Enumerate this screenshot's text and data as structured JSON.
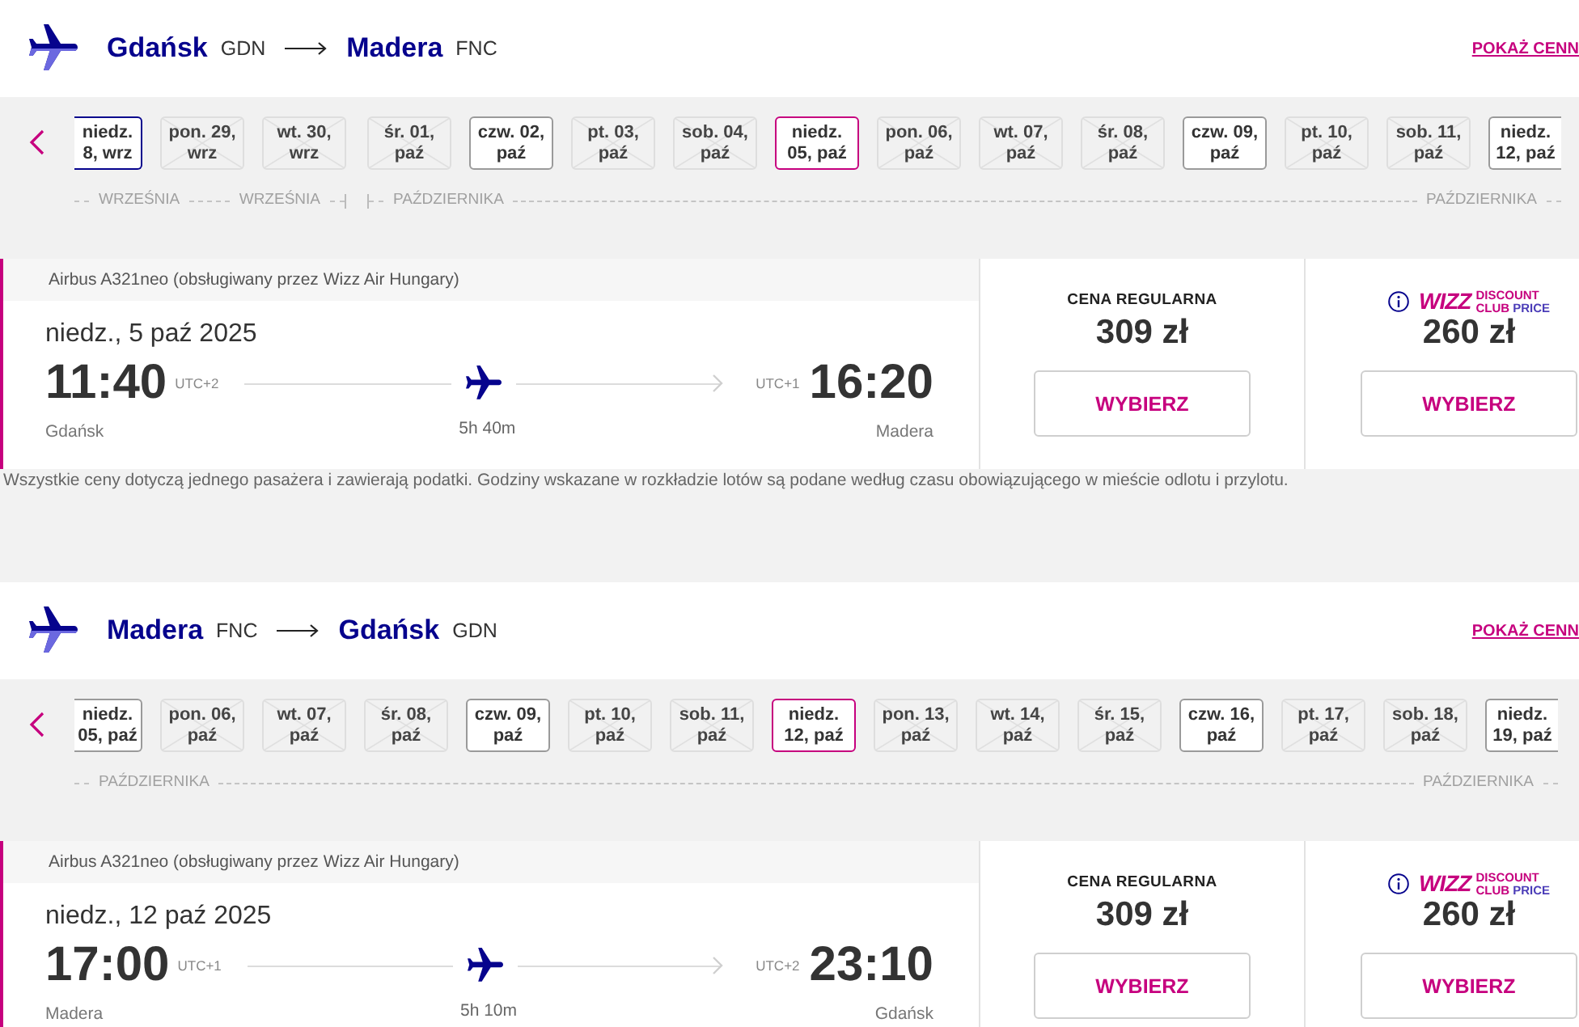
{
  "flights": [
    {
      "route": {
        "origin": "Gdańsk",
        "origin_code": "GDN",
        "destination": "Madera",
        "destination_code": "FNC"
      },
      "price_link": "POKAŻ CENN",
      "date_strip": {
        "months": [
          {
            "labels": [
              "WRZEŚNIA",
              "WRZEŚNIA"
            ],
            "days": [
              {
                "label": "niedz. 8, wrz",
                "available": true,
                "selected": false,
                "focused": true
              },
              {
                "label": "pon. 29, wrz",
                "available": false,
                "selected": false,
                "focused": false
              },
              {
                "label": "wt. 30, wrz",
                "available": false,
                "selected": false,
                "focused": false
              }
            ]
          },
          {
            "labels": [
              "PAŹDZIERNIKA",
              "PAŹDZIERNIKA"
            ],
            "days": [
              {
                "label": "śr. 01, paź",
                "available": false,
                "selected": false,
                "focused": false
              },
              {
                "label": "czw. 02, paź",
                "available": true,
                "selected": false,
                "focused": false
              },
              {
                "label": "pt. 03, paź",
                "available": false,
                "selected": false,
                "focused": false
              },
              {
                "label": "sob. 04, paź",
                "available": false,
                "selected": false,
                "focused": false
              },
              {
                "label": "niedz. 05, paź",
                "available": true,
                "selected": true,
                "focused": false
              },
              {
                "label": "pon. 06, paź",
                "available": false,
                "selected": false,
                "focused": false
              },
              {
                "label": "wt. 07, paź",
                "available": false,
                "selected": false,
                "focused": false
              },
              {
                "label": "śr. 08, paź",
                "available": false,
                "selected": false,
                "focused": false
              },
              {
                "label": "czw. 09, paź",
                "available": true,
                "selected": false,
                "focused": false
              },
              {
                "label": "pt. 10, paź",
                "available": false,
                "selected": false,
                "focused": false
              },
              {
                "label": "sob. 11, paź",
                "available": false,
                "selected": false,
                "focused": false
              },
              {
                "label": "niedz. 12, paź",
                "available": true,
                "selected": false,
                "focused": false
              }
            ]
          }
        ]
      },
      "flight": {
        "selected": true,
        "aircraft": "Airbus A321neo (obsługiwany przez Wizz Air Hungary)",
        "date": "niedz., 5 paź 2025",
        "departure": {
          "time": "11:40",
          "utc_offset": "UTC+2",
          "city": "Gdańsk"
        },
        "duration": "5h 40m",
        "arrival": {
          "time": "16:20",
          "utc_offset": "UTC+1",
          "city": "Madera"
        },
        "fares": [
          {
            "kind": "regular",
            "title": "CENA REGULARNA",
            "price": "309 zł",
            "button": "WYBIERZ"
          },
          {
            "kind": "club",
            "logo": {
              "wordmark": "WIZZ",
              "words": [
                "DISCOUNT",
                "CLUB",
                "PRICE"
              ]
            },
            "price": "260 zł",
            "button": "WYBIERZ"
          }
        ]
      },
      "note": "Wszystkie ceny dotyczą jednego pasażera i zawierają podatki. Godziny wskazane w rozkładzie lotów są podane według czasu obowiązującego w mieście odlotu i przylotu."
    },
    {
      "route": {
        "origin": "Madera",
        "origin_code": "FNC",
        "destination": "Gdańsk",
        "destination_code": "GDN"
      },
      "price_link": "POKAŻ CENN",
      "date_strip": {
        "months": [
          {
            "labels": [
              "PAŹDZIERNIKA",
              "PAŹDZIERNIKA"
            ],
            "days": [
              {
                "label": "niedz. 05, paź",
                "available": true,
                "selected": false,
                "focused": false
              },
              {
                "label": "pon. 06, paź",
                "available": false,
                "selected": false,
                "focused": false
              },
              {
                "label": "wt. 07, paź",
                "available": false,
                "selected": false,
                "focused": false
              },
              {
                "label": "śr. 08, paź",
                "available": false,
                "selected": false,
                "focused": false
              },
              {
                "label": "czw. 09, paź",
                "available": true,
                "selected": false,
                "focused": false
              },
              {
                "label": "pt. 10, paź",
                "available": false,
                "selected": false,
                "focused": false
              },
              {
                "label": "sob. 11, paź",
                "available": false,
                "selected": false,
                "focused": false
              },
              {
                "label": "niedz. 12, paź",
                "available": true,
                "selected": true,
                "focused": false
              },
              {
                "label": "pon. 13, paź",
                "available": false,
                "selected": false,
                "focused": false
              },
              {
                "label": "wt. 14, paź",
                "available": false,
                "selected": false,
                "focused": false
              },
              {
                "label": "śr. 15, paź",
                "available": false,
                "selected": false,
                "focused": false
              },
              {
                "label": "czw. 16, paź",
                "available": true,
                "selected": false,
                "focused": false
              },
              {
                "label": "pt. 17, paź",
                "available": false,
                "selected": false,
                "focused": false
              },
              {
                "label": "sob. 18, paź",
                "available": false,
                "selected": false,
                "focused": false
              },
              {
                "label": "niedz. 19, paź",
                "available": true,
                "selected": false,
                "focused": false
              }
            ]
          }
        ]
      },
      "flight": {
        "selected": true,
        "aircraft": "Airbus A321neo (obsługiwany przez Wizz Air Hungary)",
        "date": "niedz., 12 paź 2025",
        "departure": {
          "time": "17:00",
          "utc_offset": "UTC+1",
          "city": "Madera"
        },
        "duration": "5h 10m",
        "arrival": {
          "time": "23:10",
          "utc_offset": "UTC+2",
          "city": "Gdańsk"
        },
        "fares": [
          {
            "kind": "regular",
            "title": "CENA REGULARNA",
            "price": "309 zł",
            "button": "WYBIERZ"
          },
          {
            "kind": "club",
            "logo": {
              "wordmark": "WIZZ",
              "words": [
                "DISCOUNT",
                "CLUB",
                "PRICE"
              ]
            },
            "price": "260 zł",
            "button": "WYBIERZ"
          }
        ]
      }
    }
  ]
}
